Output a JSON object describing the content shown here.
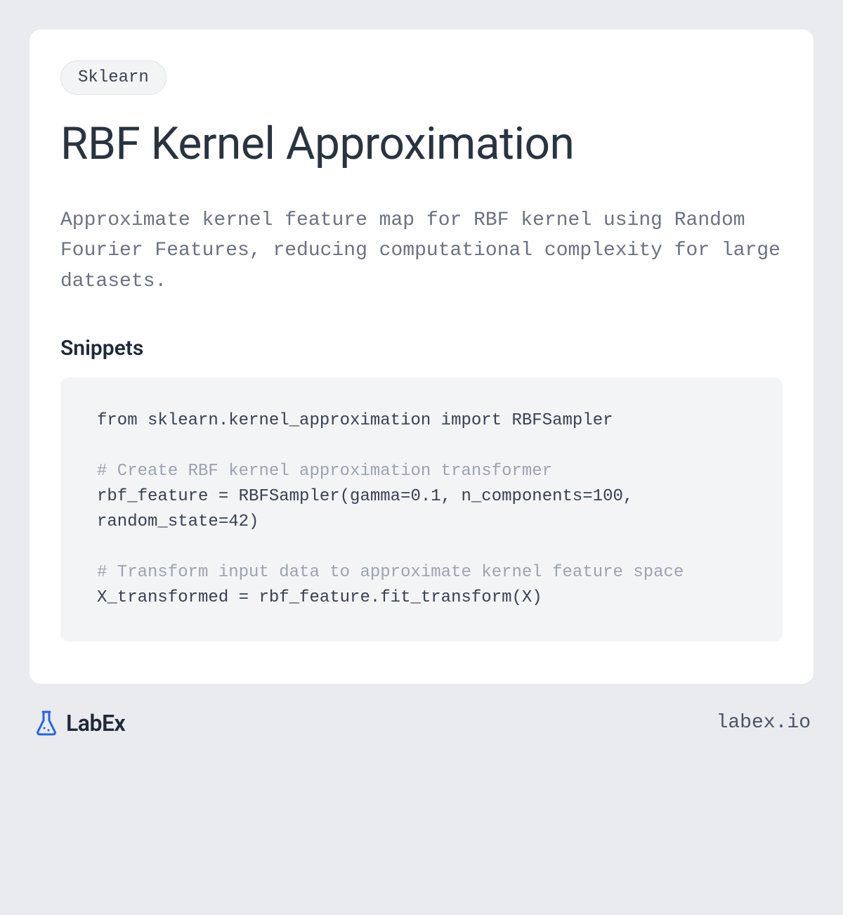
{
  "tag": "Sklearn",
  "title": "RBF Kernel Approximation",
  "description": "Approximate kernel feature map for RBF kernel using Random Fourier Features, reducing computational complexity for large datasets.",
  "section_heading": "Snippets",
  "code": {
    "line1": "from sklearn.kernel_approximation import RBFSampler",
    "comment1": "# Create RBF kernel approximation transformer",
    "line2": "rbf_feature = RBFSampler(gamma=0.1, n_components=100, random_state=42)",
    "comment2": "# Transform input data to approximate kernel feature space",
    "line3": "X_transformed = rbf_feature.fit_transform(X)"
  },
  "footer": {
    "logo_text": "LabEx",
    "url": "labex.io"
  }
}
